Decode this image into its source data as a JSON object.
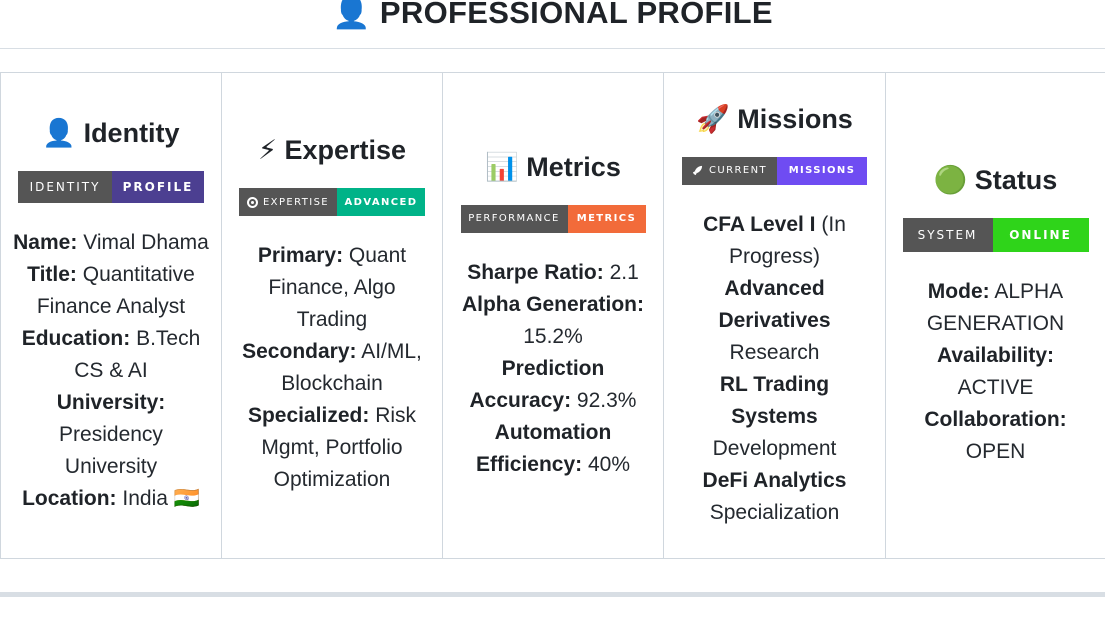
{
  "header": {
    "icon": "👤",
    "title": "PROFESSIONAL PROFILE"
  },
  "identity": {
    "icon": "👤",
    "title": "Identity",
    "badge": {
      "left": "IDENTITY",
      "right": "PROFILE",
      "right_color": "#4c3f91"
    },
    "fields": [
      {
        "label": "Name:",
        "value": "Vimal Dhama"
      },
      {
        "label": "Title:",
        "value": "Quantitative Finance Analyst"
      },
      {
        "label": "Education:",
        "value": "B.Tech CS & AI"
      },
      {
        "label": "University:",
        "value": "Presidency University"
      },
      {
        "label": "Location:",
        "value": "India 🇮🇳"
      }
    ]
  },
  "expertise": {
    "icon": "⚡",
    "title": "Expertise",
    "badge": {
      "left": "EXPERTISE",
      "right": "ADVANCED",
      "right_color": "#00b388",
      "logo": "gear-icon"
    },
    "fields": [
      {
        "label": "Primary:",
        "value": "Quant Finance, Algo Trading"
      },
      {
        "label": "Secondary:",
        "value": "AI/ML, Blockchain"
      },
      {
        "label": "Specialized:",
        "value": "Risk Mgmt, Portfolio Optimization"
      }
    ]
  },
  "metrics": {
    "icon": "📊",
    "title": "Metrics",
    "badge": {
      "left": "PERFORMANCE",
      "right": "METRICS",
      "right_color": "#f26b3a"
    },
    "fields": [
      {
        "label": "Sharpe Ratio:",
        "value": "2.1"
      },
      {
        "label": "Alpha Generation:",
        "value": "15.2%"
      },
      {
        "label": "Prediction Accuracy:",
        "value": "92.3%"
      },
      {
        "label": "Automation Efficiency:",
        "value": "40%"
      }
    ]
  },
  "missions": {
    "icon": "🚀",
    "title": "Missions",
    "badge": {
      "left": "CURRENT",
      "right": "MISSIONS",
      "right_color": "#6f4cf2",
      "logo": "rocket-icon"
    },
    "items": [
      {
        "bold": "CFA Level I",
        "rest": "(In Progress)"
      },
      {
        "bold": "Advanced Derivatives",
        "rest": "Research"
      },
      {
        "bold": "RL Trading Systems",
        "rest": "Development"
      },
      {
        "bold": "DeFi Analytics",
        "rest": "Specialization"
      }
    ]
  },
  "status": {
    "icon": "🟢",
    "title": "Status",
    "badge": {
      "left": "SYSTEM",
      "right": "ONLINE",
      "right_color": "#2fd41a"
    },
    "fields": [
      {
        "label": "Mode:",
        "value": "ALPHA GENERATION"
      },
      {
        "label": "Availability:",
        "value": "ACTIVE"
      },
      {
        "label": "Collaboration:",
        "value": "OPEN"
      }
    ]
  }
}
